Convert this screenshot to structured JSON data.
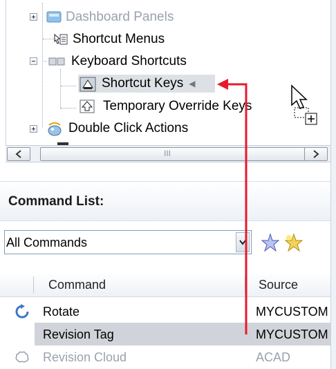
{
  "tree": {
    "items": [
      {
        "label": "Dashboard Panels",
        "icon": "dashboard-panels-icon",
        "dimmed": true
      },
      {
        "label": "Shortcut Menus",
        "icon": "shortcut-menus-icon"
      },
      {
        "label": "Keyboard Shortcuts",
        "icon": "keyboard-icon"
      },
      {
        "label": "Shortcut Keys",
        "icon": "shortcut-keys-icon",
        "selected": true
      },
      {
        "label": "Temporary Override Keys",
        "icon": "temporary-override-icon"
      },
      {
        "label": "Double Click Actions",
        "icon": "double-click-icon"
      }
    ]
  },
  "scrollbar": {
    "grip": "III"
  },
  "command_list": {
    "title": "Command List:",
    "filter": {
      "value": "All Commands"
    },
    "columns": {
      "command": "Command",
      "source": "Source"
    },
    "rows": [
      {
        "name": "Rotate",
        "source": "MYCUSTOM",
        "icon": "rotate-icon"
      },
      {
        "name": "Revision Tag",
        "source": "MYCUSTOM",
        "icon": "",
        "selected": true
      },
      {
        "name": "Revision Cloud",
        "source": "ACAD",
        "icon": "revision-cloud-icon",
        "dimmed": true
      }
    ]
  },
  "colors": {
    "accent": "#e8192c",
    "selection": "#d0d3d9",
    "header_bg": "#edf1f6"
  }
}
